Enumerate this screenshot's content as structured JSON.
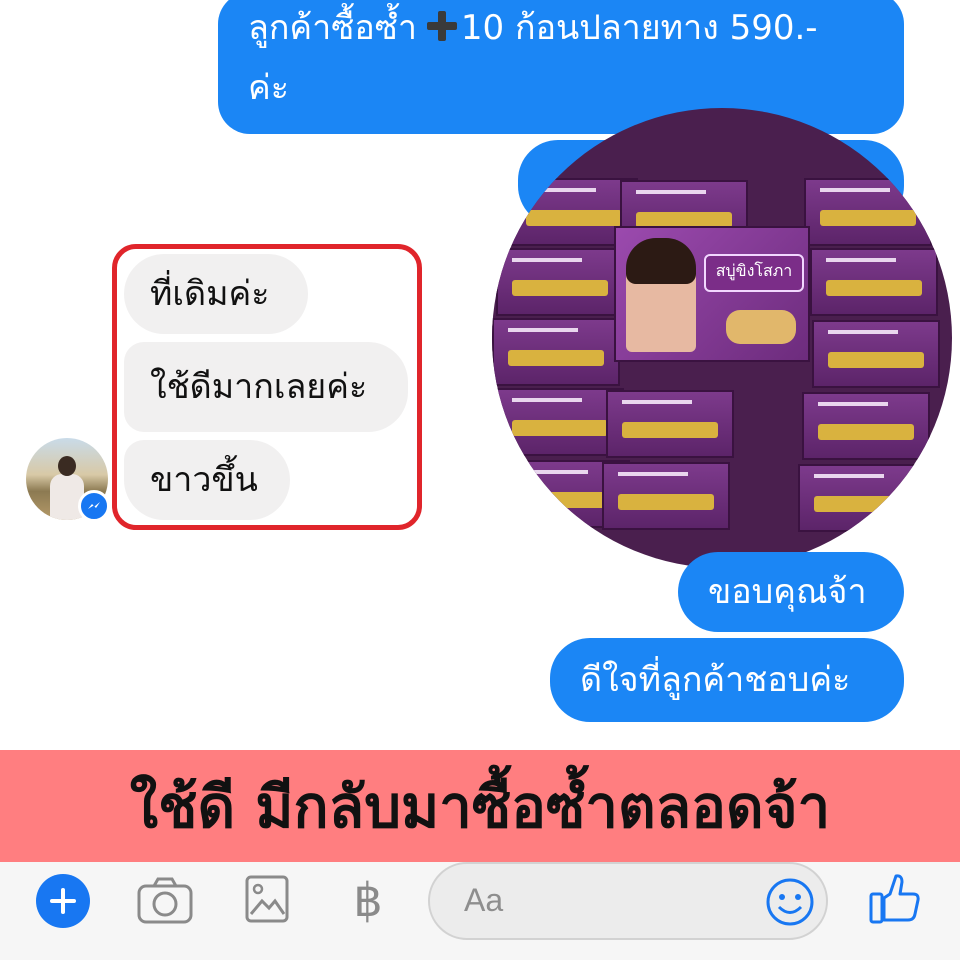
{
  "conversation": {
    "outgoing": [
      {
        "text_before": "ลูกค้าซื้อซ้ำ",
        "icon": "heavy-plus-icon",
        "text_after": "10 ก้อนปลายทาง 590.-",
        "line2": "ค่ะ"
      },
      {
        "text": "ขอบคุณจ้า"
      },
      {
        "text": "ดีใจที่ลูกค้าชอบค่ะ"
      }
    ],
    "incoming": [
      {
        "text": "ที่เดิมค่ะ"
      },
      {
        "text": "ใช้ดีมากเลยค่ะ"
      },
      {
        "text": "ขาวขึ้น"
      }
    ],
    "contact_avatar": "avatar-woman-outdoors",
    "highlight_color": "#e0252b",
    "product_photo": {
      "label": "สบู่ขิงโสภา",
      "description_icon": "soap-boxes-photo"
    }
  },
  "banner": {
    "text": "ใช้ดี มีกลับมาซื้อซ้ำตลอดจ้า",
    "background": "#ff7e80"
  },
  "composer": {
    "placeholder": "Aa",
    "icons": [
      "plus-icon",
      "camera-icon",
      "image-icon",
      "baht-icon",
      "emoji-icon",
      "thumbs-up-icon"
    ],
    "baht_symbol": "฿",
    "accent": "#1877f2"
  }
}
